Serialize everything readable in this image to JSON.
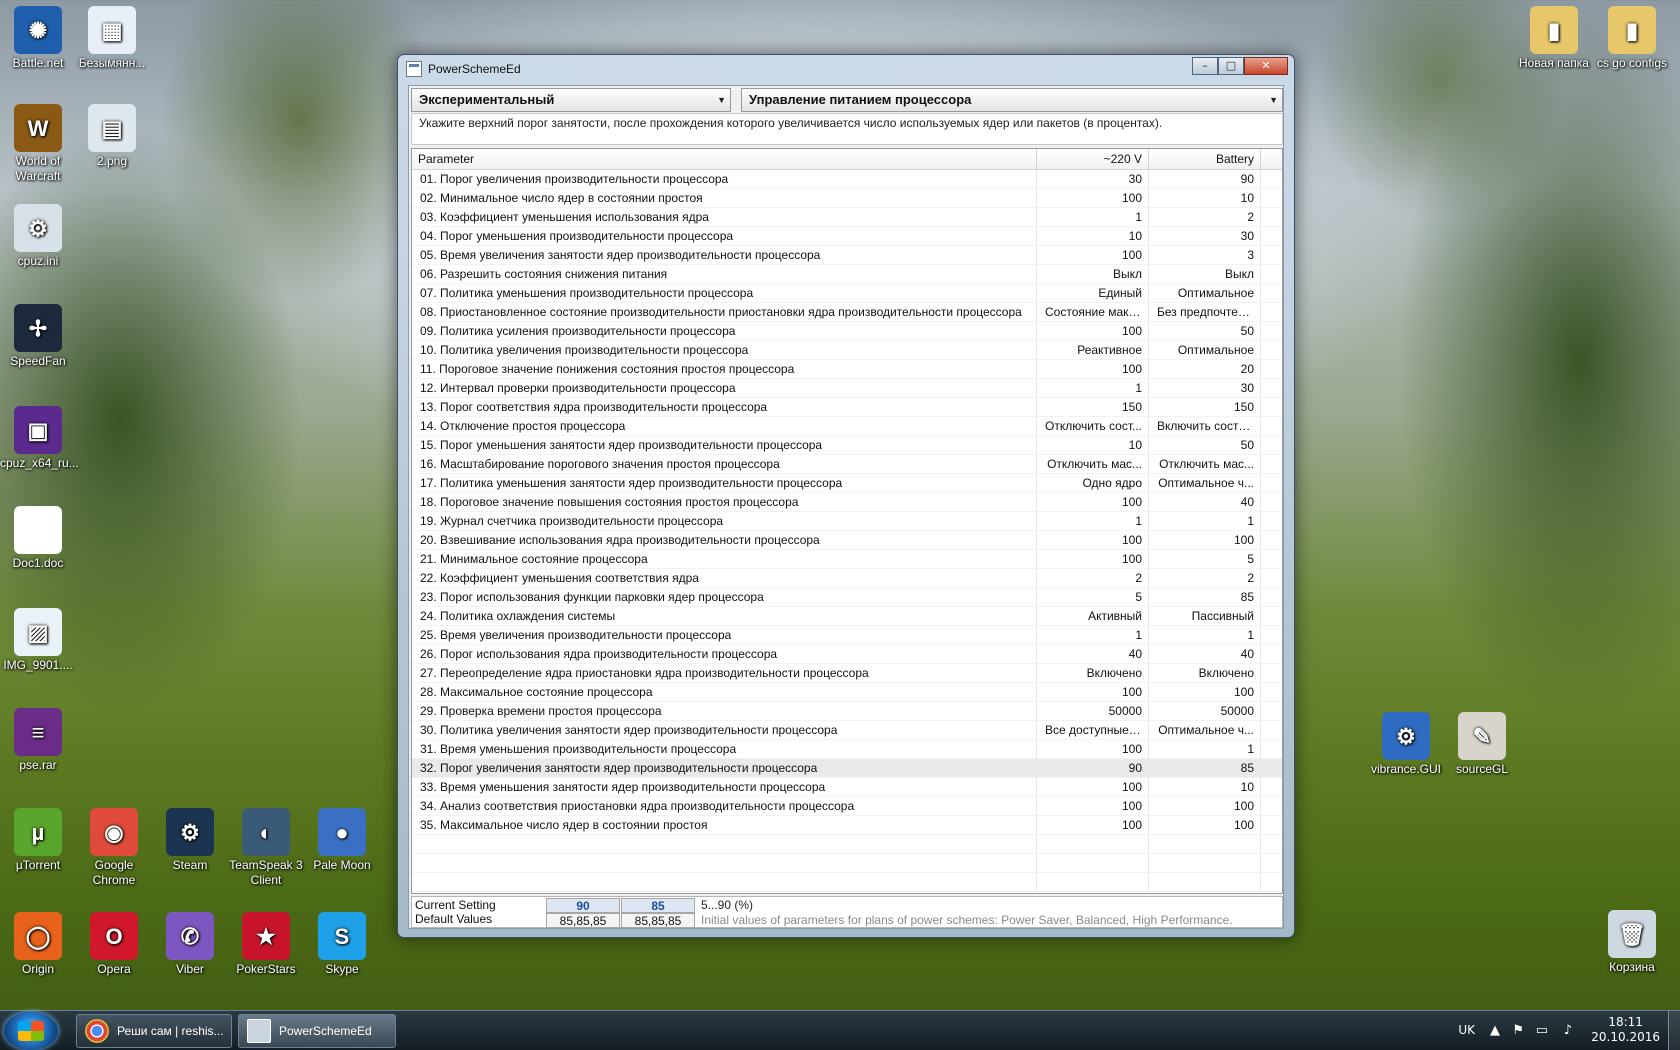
{
  "desktop": {
    "icons_left": [
      {
        "label": "Battle.net",
        "color": "#1f5fae",
        "glyph": "✺"
      },
      {
        "label": "Безымянн...",
        "color": "#e8eef6",
        "glyph": "▦"
      },
      {
        "label": "World of Warcraft",
        "color": "#8a5a14",
        "glyph": "W"
      },
      {
        "label": "2.png",
        "color": "#dfe7ef",
        "glyph": "▤"
      },
      {
        "label": "cpuz.ini",
        "color": "#d8e0e8",
        "glyph": "⚙"
      },
      {
        "label": "SpeedFan",
        "color": "#1d2a3d",
        "glyph": "✢"
      },
      {
        "label": "cpuz_x64_ru...",
        "color": "#5a2a8e",
        "glyph": "▣"
      },
      {
        "label": "Doc1.doc",
        "color": "#ffffff",
        "glyph": ""
      },
      {
        "label": "IMG_9901....",
        "color": "#eaf1f7",
        "glyph": "▨"
      },
      {
        "label": "pse.rar",
        "color": "#6a2c86",
        "glyph": "≡"
      }
    ],
    "icons_bottom_row1": [
      {
        "label": "µTorrent",
        "color": "#5aa52c",
        "glyph": "µ"
      },
      {
        "label": "Google Chrome",
        "color": "#e04a3a",
        "glyph": "◉"
      },
      {
        "label": "Steam",
        "color": "#1b3450",
        "glyph": "⚙"
      },
      {
        "label": "TeamSpeak 3 Client",
        "color": "#3a5a78",
        "glyph": "◐"
      },
      {
        "label": "Pale Moon",
        "color": "#3a6fc4",
        "glyph": "●"
      }
    ],
    "icons_bottom_row2": [
      {
        "label": "Origin",
        "color": "#e8621c",
        "glyph": "◯"
      },
      {
        "label": "Opera",
        "color": "#d0172b",
        "glyph": "O"
      },
      {
        "label": "Viber",
        "color": "#7d57c1",
        "glyph": "✆"
      },
      {
        "label": "PokerStars",
        "color": "#c8142a",
        "glyph": "★"
      },
      {
        "label": "Skype",
        "color": "#1ea1e8",
        "glyph": "S"
      }
    ],
    "icons_right": [
      {
        "label": "vibrance.GUI",
        "color": "#2f6bc0",
        "glyph": "⚙"
      },
      {
        "label": "sourceGL",
        "color": "#d8d4cc",
        "glyph": "✎"
      },
      {
        "label": "Новая папка",
        "color": "#e8c66a",
        "glyph": "▮"
      },
      {
        "label": "cs go configs",
        "color": "#e8c66a",
        "glyph": "▮"
      },
      {
        "label": "Корзина",
        "color": "#cfd8e0",
        "glyph": "🗑"
      }
    ]
  },
  "window": {
    "title": "PowerSchemeEd",
    "scheme_combo": "Экспериментальный",
    "group_combo": "Управление питанием процессора",
    "description": "Укажите верхний порог занятости, после прохождения которого увеличивается число используемых ядер или пакетов (в процентах).",
    "columns": [
      "Parameter",
      "~220 V",
      "Battery"
    ],
    "rows": [
      [
        "01. Порог увеличения производительности процессора",
        "30",
        "90"
      ],
      [
        "02. Минимальное число ядер в состоянии простоя",
        "100",
        "10"
      ],
      [
        "03. Коэффициент уменьшения использования ядра",
        "1",
        "2"
      ],
      [
        "04. Порог уменьшения производительности процессора",
        "10",
        "30"
      ],
      [
        "05. Время увеличения занятости ядер производительности процессора",
        "100",
        "3"
      ],
      [
        "06. Разрешить состояния снижения питания",
        "Выкл",
        "Выкл"
      ],
      [
        "07. Политика уменьшения производительности процессора",
        "Единый",
        "Оптимальное"
      ],
      [
        "08. Приостановленное состояние производительности приостановки ядра производительности процессора",
        "Состояние макс...",
        "Без предпочтений"
      ],
      [
        "09. Политика усиления производительности процессора",
        "100",
        "50"
      ],
      [
        "10. Политика увеличения производительности процессора",
        "Реактивное",
        "Оптимальное"
      ],
      [
        "11. Пороговое значение понижения состояния простоя процессора",
        "100",
        "20"
      ],
      [
        "12. Интервал проверки производительности процессора",
        "1",
        "30"
      ],
      [
        "13. Порог соответствия ядра производительности процессора",
        "150",
        "150"
      ],
      [
        "14. Отключение простоя процессора",
        "Отключить сост...",
        "Включить состо..."
      ],
      [
        "15. Порог уменьшения занятости ядер производительности процессора",
        "10",
        "50"
      ],
      [
        "16. Масштабирование порогового значения простоя процессора",
        "Отключить мас...",
        "Отключить мас..."
      ],
      [
        "17. Политика уменьшения занятости ядер производительности процессора",
        "Одно ядро",
        "Оптимальное ч..."
      ],
      [
        "18. Пороговое значение повышения состояния простоя процессора",
        "100",
        "40"
      ],
      [
        "19. Журнал счетчика производительности процессора",
        "1",
        "1"
      ],
      [
        "20. Взвешивание использования ядра производительности процессора",
        "100",
        "100"
      ],
      [
        "21. Минимальное состояние процессора",
        "100",
        "5"
      ],
      [
        "22. Коэффициент уменьшения соответствия ядра",
        "2",
        "2"
      ],
      [
        "23. Порог использования функции парковки ядер процессора",
        "5",
        "85"
      ],
      [
        "24. Политика охлаждения системы",
        "Активный",
        "Пассивный"
      ],
      [
        "25. Время увеличения производительности процессора",
        "1",
        "1"
      ],
      [
        "26. Порог использования ядра производительности процессора",
        "40",
        "40"
      ],
      [
        "27. Переопределение ядра приостановки ядра производительности процессора",
        "Включено",
        "Включено"
      ],
      [
        "28. Максимальное состояние процессора",
        "100",
        "100"
      ],
      [
        "29. Проверка времени простоя процессора",
        "50000",
        "50000"
      ],
      [
        "30. Политика увеличения занятости ядер производительности процессора",
        "Все доступные я...",
        "Оптимальное ч..."
      ],
      [
        "31. Время уменьшения производительности процессора",
        "100",
        "1"
      ],
      [
        "32. Порог увеличения занятости ядер производительности процессора",
        "90",
        "85"
      ],
      [
        "33. Время уменьшения занятости ядер производительности процессора",
        "100",
        "10"
      ],
      [
        "34. Анализ соответствия приостановки ядра производительности процессора",
        "100",
        "100"
      ],
      [
        "35. Максимальное число ядер в состоянии простоя",
        "100",
        "100"
      ]
    ],
    "selected_row_index": 31,
    "current_setting_label": "Current Setting",
    "default_values_label": "Default Values",
    "current_ac": "90",
    "current_dc": "85",
    "range_text": "5...90 (%)",
    "default_ac": "85,85,85",
    "default_dc": "85,85,85",
    "default_hint": "Initial values of parameters for plans of power schemes: Power Saver, Balanced, High Performance."
  },
  "taskbar": {
    "buttons": [
      {
        "label": "Реши сам | reshis...",
        "color": "#e0453a"
      },
      {
        "label": "PowerSchemeEd",
        "color": "#c9d4de"
      }
    ],
    "lang": "UK",
    "time": "18:11",
    "date": "20.10.2016"
  }
}
